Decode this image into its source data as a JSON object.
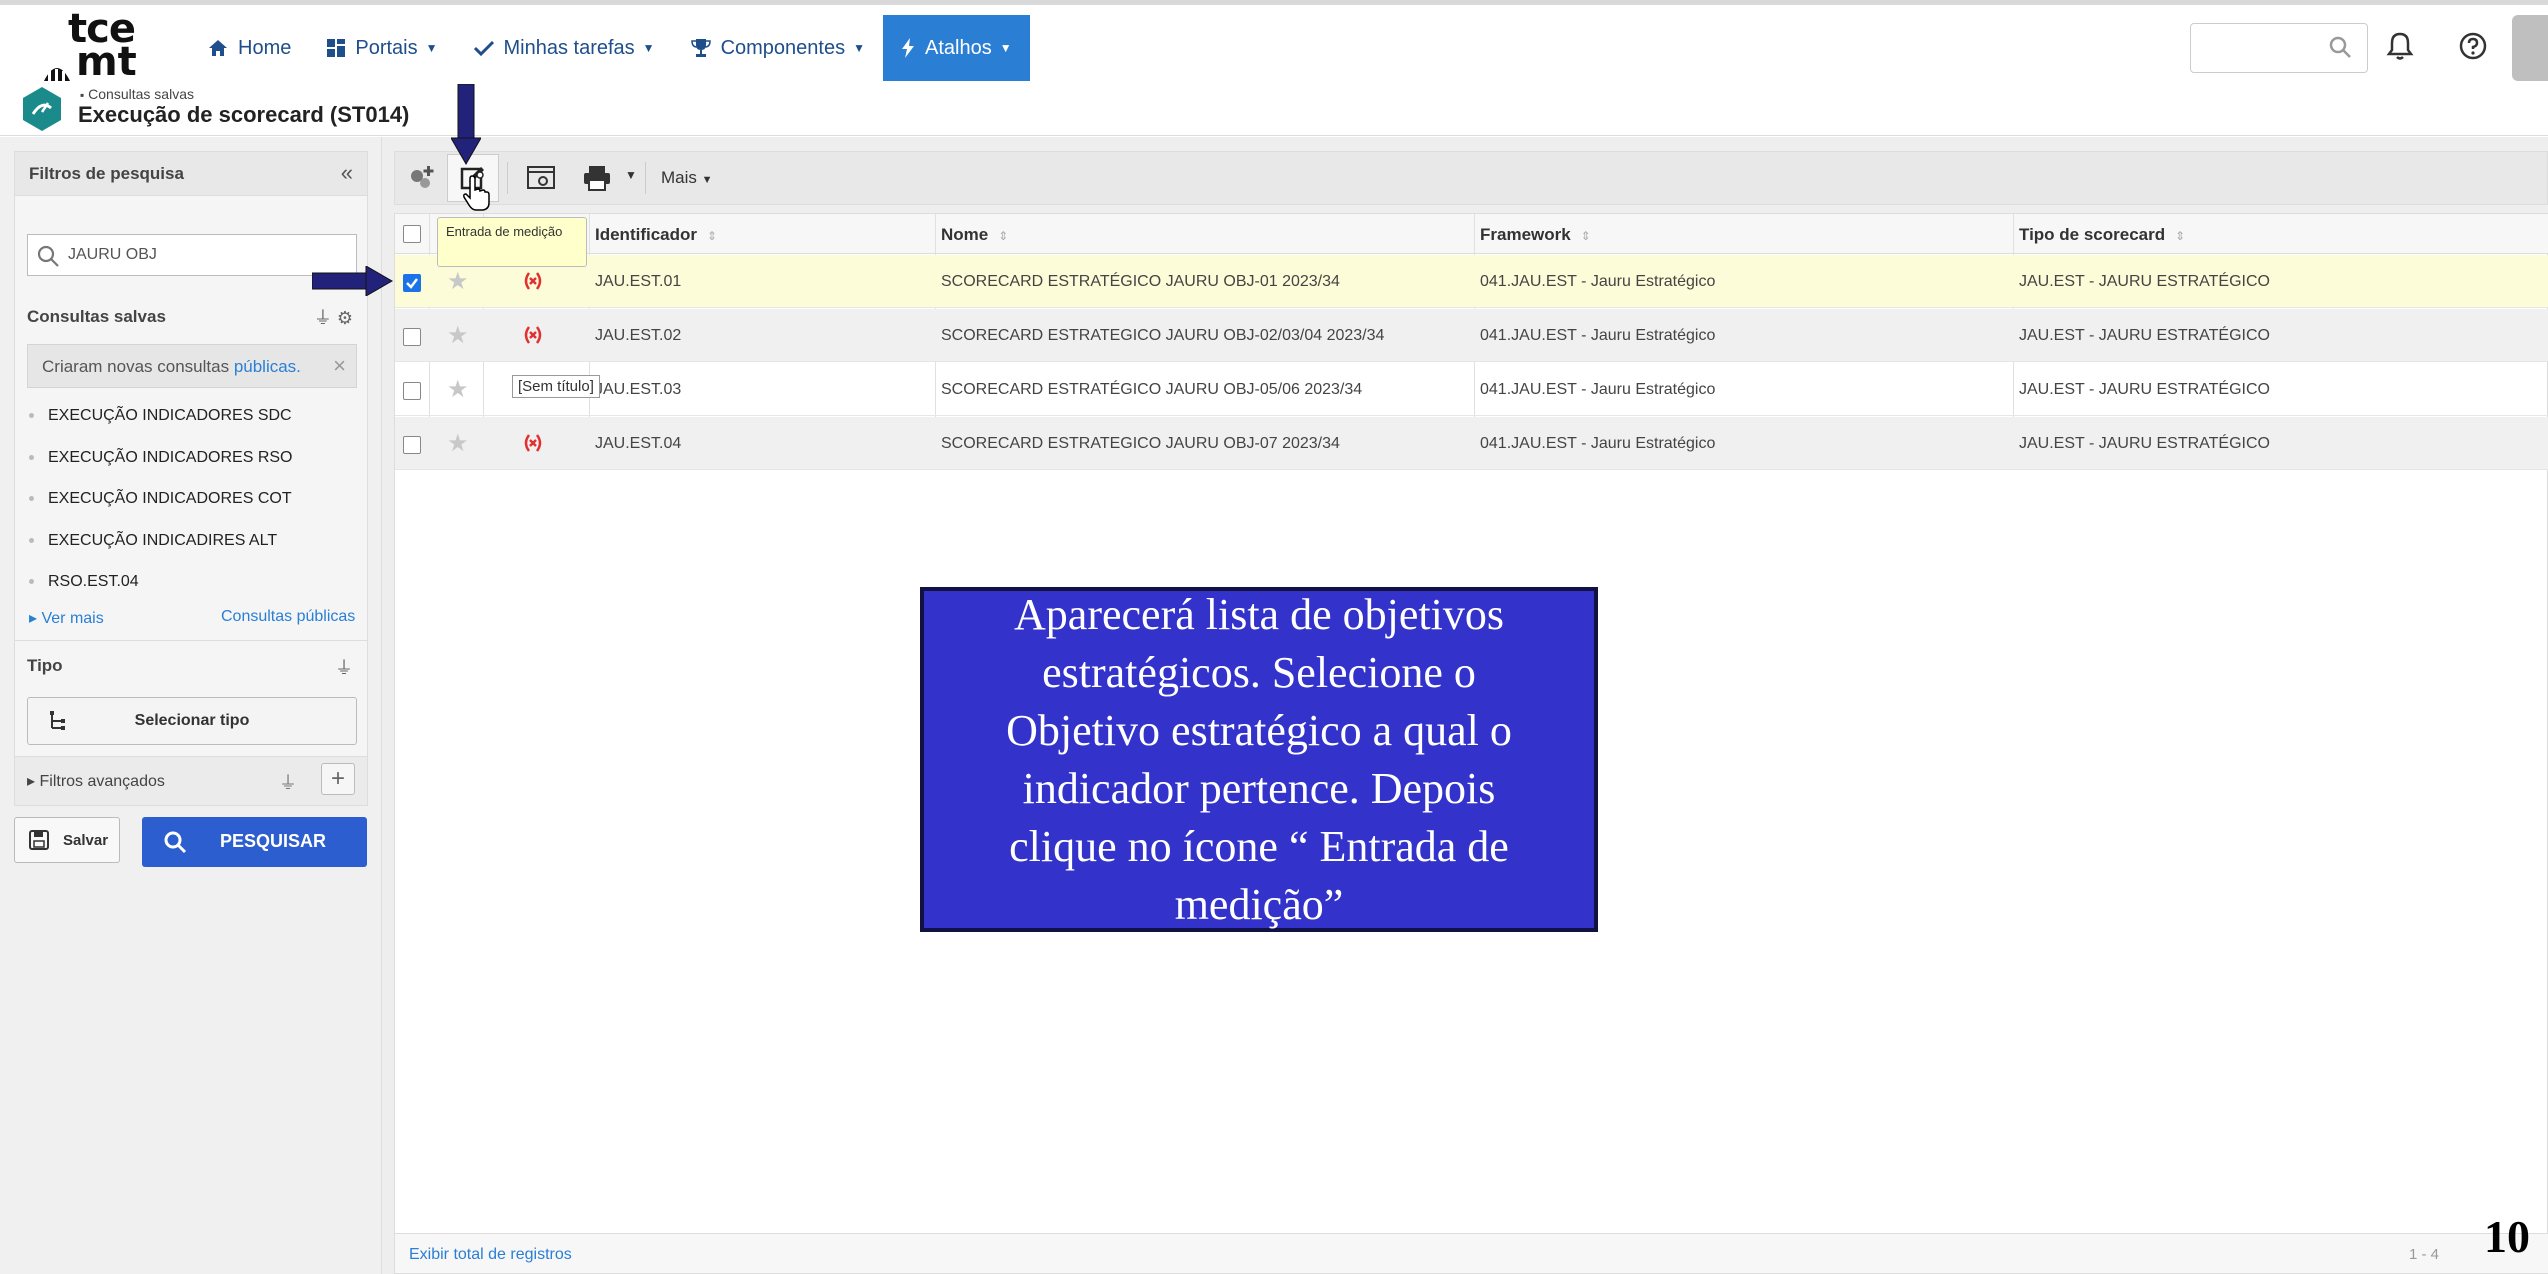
{
  "app": {
    "logo_top": "tce",
    "logo_bottom": "mt"
  },
  "nav": {
    "home": "Home",
    "portais": "Portais",
    "tarefas": "Minhas tarefas",
    "componentes": "Componentes",
    "atalhos": "Atalhos"
  },
  "breadcrumb": {
    "parent": "Consultas salvas",
    "title": "Execução de scorecard (ST014)"
  },
  "sidebar": {
    "title": "Filtros de pesquisa",
    "search_value": "JAURU OBJ",
    "saved_title": "Consultas salvas",
    "notice_text": "Criaram novas consultas ",
    "notice_link": "públicas.",
    "saved_items": [
      "EXECUÇÃO INDICADORES SDC",
      "EXECUÇÃO INDICADORES RSO",
      "EXECUÇÃO INDICADORES COT",
      "EXECUÇÃO INDICADIRES ALT",
      "RSO.EST.04"
    ],
    "see_more": "Ver mais",
    "public_queries": "Consultas públicas",
    "type_title": "Tipo",
    "select_type": "Selecionar tipo",
    "advanced": "Filtros avançados",
    "save_label": "Salvar",
    "search_label": "PESQUISAR"
  },
  "toolbar": {
    "more": "Mais",
    "tooltip": "Entrada de medição"
  },
  "table": {
    "columns": [
      "Identificador",
      "Nome",
      "Framework",
      "Tipo de scorecard"
    ],
    "rows": [
      {
        "id": "JAU.EST.01",
        "name": "SCORECARD ESTRATÉGICO JAURU OBJ-01 2023/34",
        "framework": "041.JAU.EST - Jauru Estratégico",
        "type": "JAU.EST - JAURU ESTRATÉGICO",
        "checked": true
      },
      {
        "id": "JAU.EST.02",
        "name": "SCORECARD ESTRATEGICO JAURU OBJ-02/03/04 2023/34",
        "framework": "041.JAU.EST - Jauru Estratégico",
        "type": "JAU.EST - JAURU ESTRATÉGICO",
        "checked": false
      },
      {
        "id": "JAU.EST.03",
        "name": "SCORECARD ESTRATÉGICO JAURU OBJ-05/06 2023/34",
        "framework": "041.JAU.EST - Jauru Estratégico",
        "type": "JAU.EST - JAURU ESTRATÉGICO",
        "checked": false
      },
      {
        "id": "JAU.EST.04",
        "name": "SCORECARD ESTRATEGICO JAURU OBJ-07 2023/34",
        "framework": "041.JAU.EST - Jauru Estratégico",
        "type": "JAU.EST - JAURU ESTRATÉGICO",
        "checked": false
      }
    ],
    "row_tooltip": "[Sem título]",
    "footer_total": "Exibir total de registros",
    "footer_range": "1 - 4"
  },
  "callout": {
    "text": "Aparecerá lista de objetivos estratégicos. Selecione o Objetivo estratégico a qual o indicador pertence. Depois clique no ícone “ Entrada de medição”"
  },
  "slide_number": "10",
  "colors": {
    "accent": "#2a7fd4",
    "callout_bg": "#3333cc",
    "arrow": "#22227a",
    "selected_row": "#fcfcd9",
    "status_red": "#e03030"
  },
  "icons": [
    "home-icon",
    "grid-icon",
    "check-icon",
    "trophy-icon",
    "bolt-icon",
    "search-icon",
    "bell-icon",
    "help-icon",
    "collapse-icon",
    "gear-icon",
    "print-icon",
    "star-icon",
    "status-icon"
  ]
}
